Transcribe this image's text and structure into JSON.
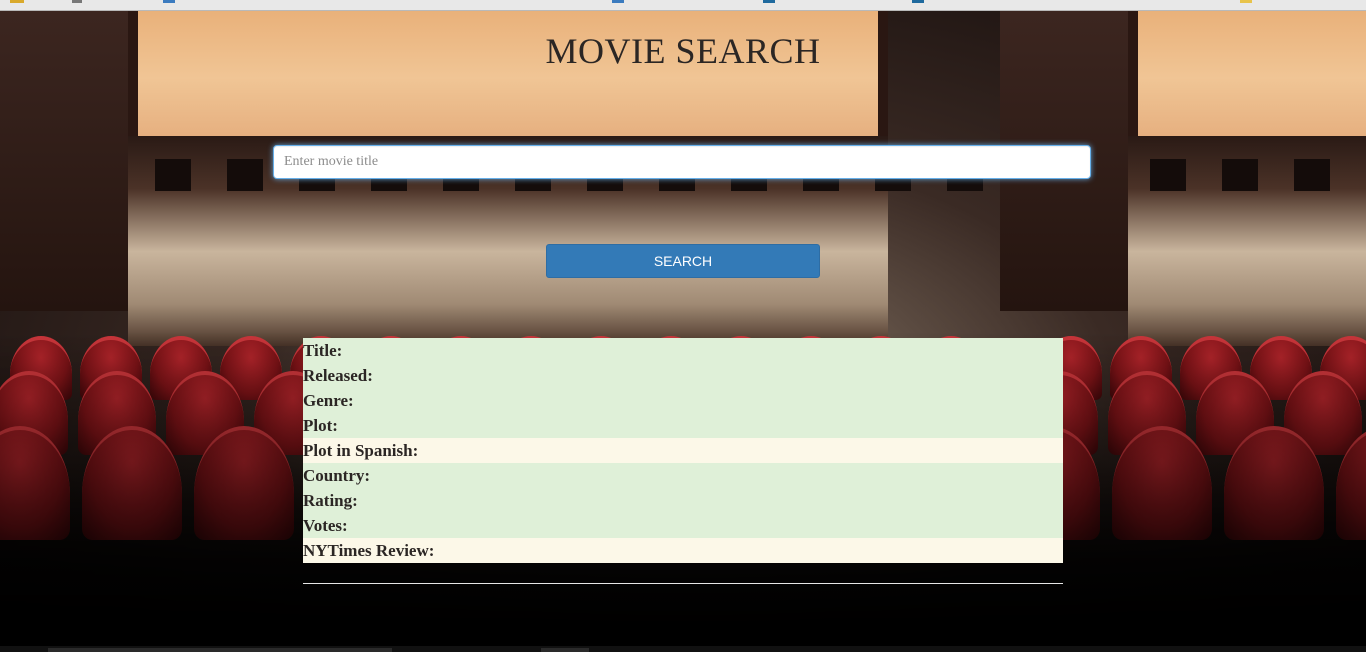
{
  "page": {
    "title": "MOVIE SEARCH"
  },
  "search": {
    "placeholder": "Enter movie title",
    "value": "",
    "button_label": "SEARCH"
  },
  "results": {
    "fields": [
      {
        "label": "Title:",
        "style": "green"
      },
      {
        "label": "Released:",
        "style": "green"
      },
      {
        "label": "Genre:",
        "style": "green"
      },
      {
        "label": "Plot:",
        "style": "green"
      },
      {
        "label": "Plot in Spanish:",
        "style": "yellow"
      },
      {
        "label": "Country:",
        "style": "green"
      },
      {
        "label": "Rating:",
        "style": "green"
      },
      {
        "label": "Votes:",
        "style": "green"
      },
      {
        "label": "NYTimes Review:",
        "style": "yellow"
      }
    ]
  },
  "colors": {
    "button": "#337ab7",
    "row_green": "#dff0d8",
    "row_yellow": "#fcf8e8",
    "input_focus": "#66afe9"
  }
}
